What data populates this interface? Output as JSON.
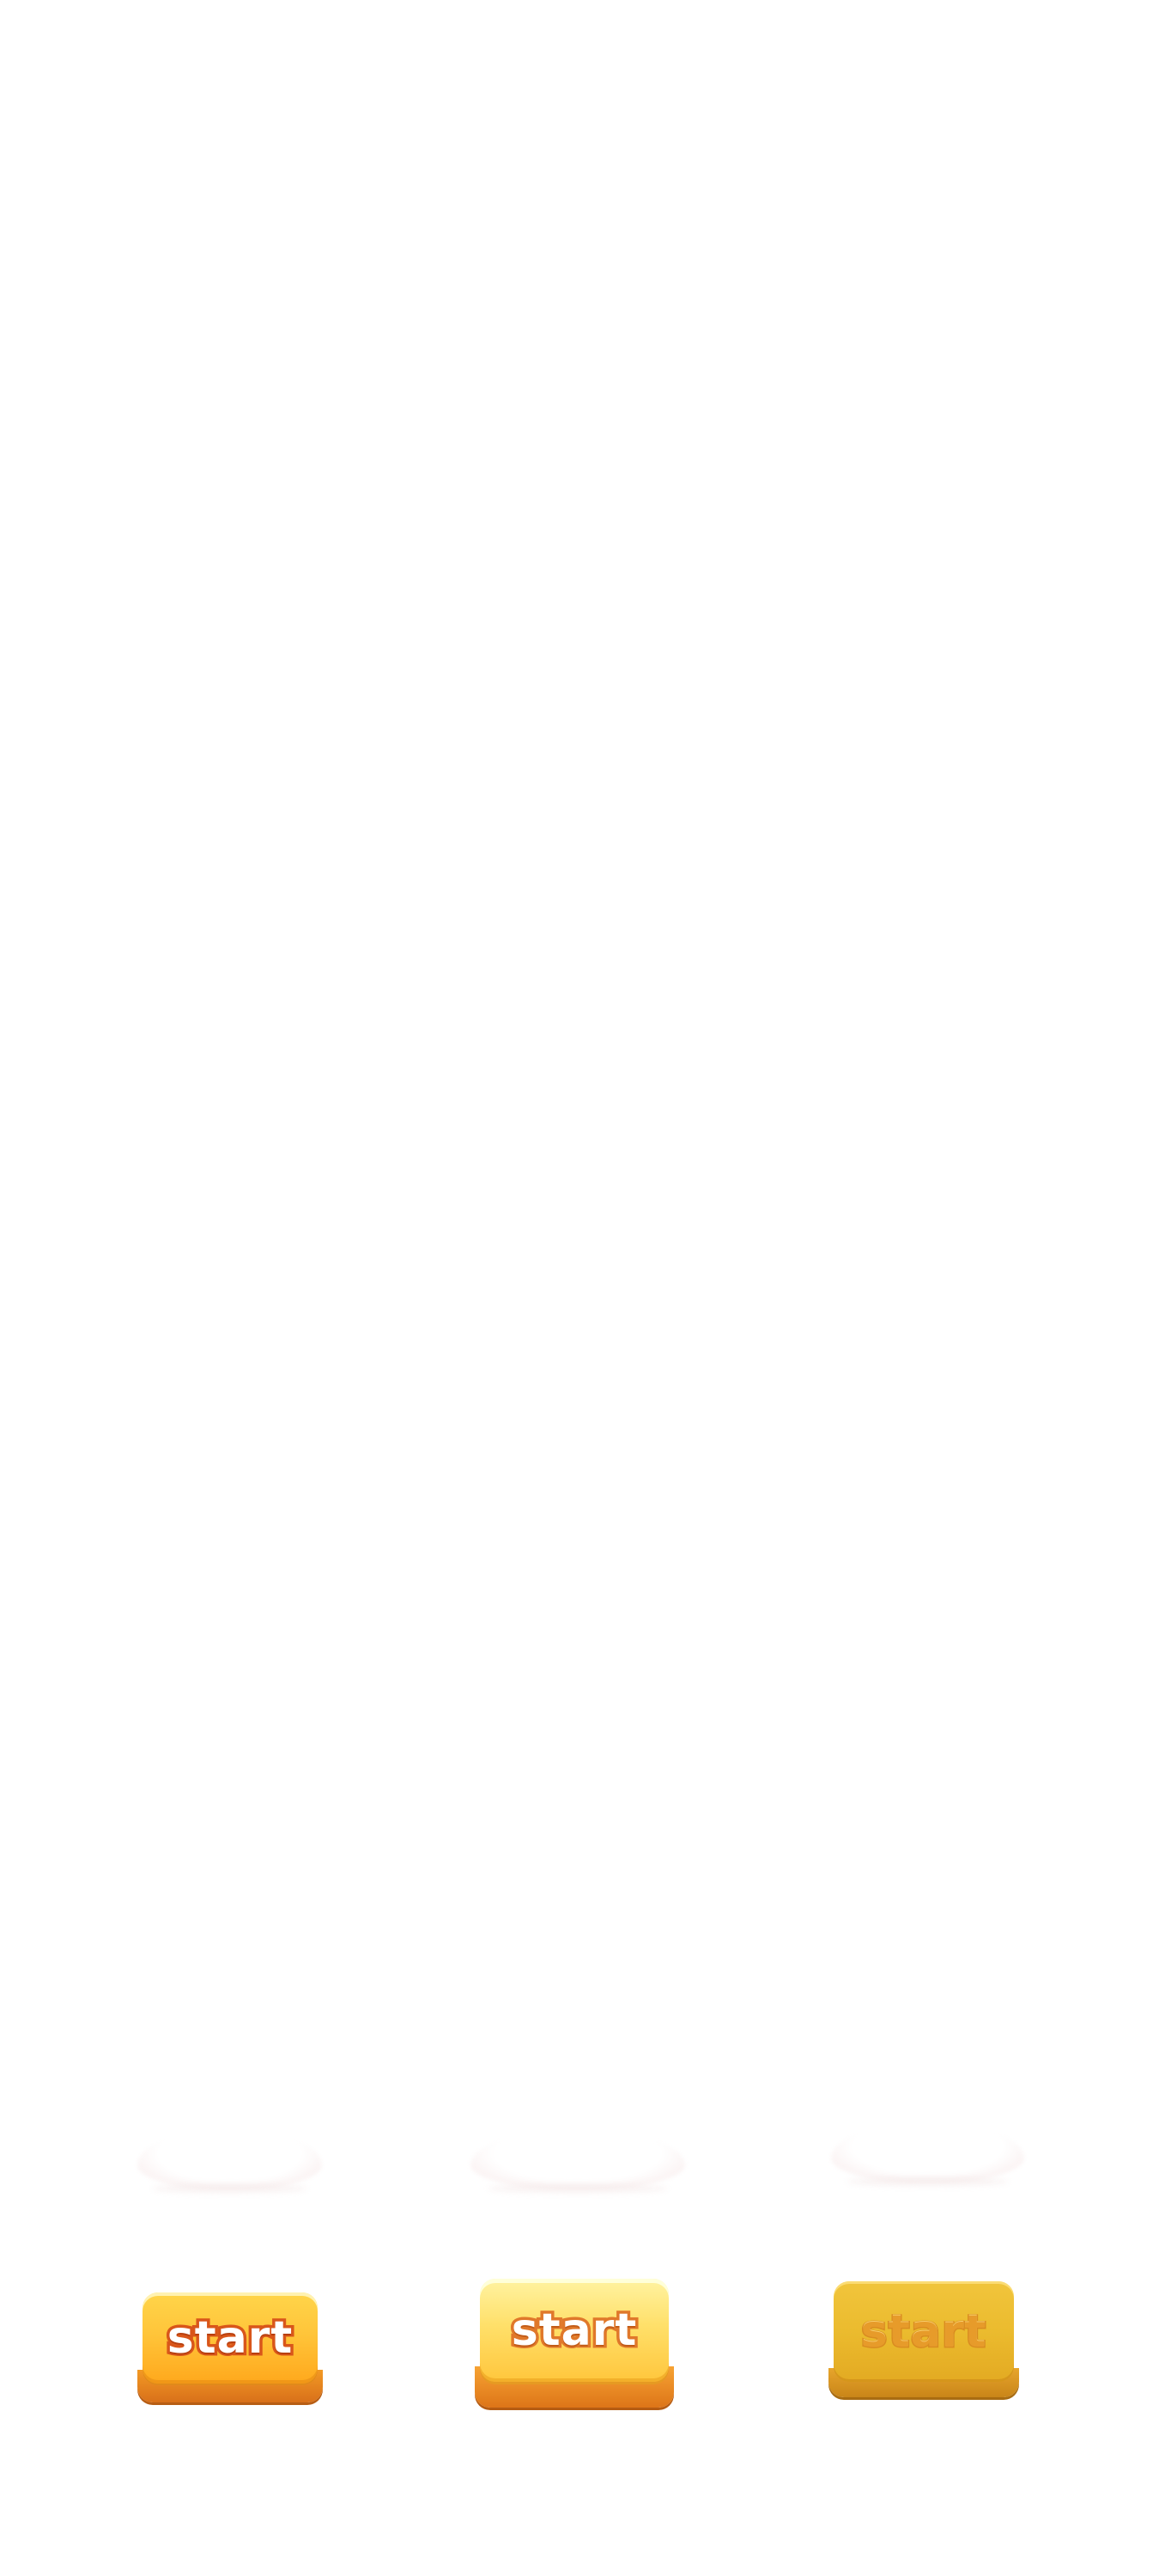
{
  "buttons": [
    {
      "label": "start",
      "state": "normal"
    },
    {
      "label": "start",
      "state": "hover"
    },
    {
      "label": "start",
      "state": "disabled"
    }
  ],
  "colors": {
    "background": "#ffffff",
    "button_gold": "#ffc53a",
    "button_base": "#f39a24",
    "label_outline": "#d9561a"
  }
}
